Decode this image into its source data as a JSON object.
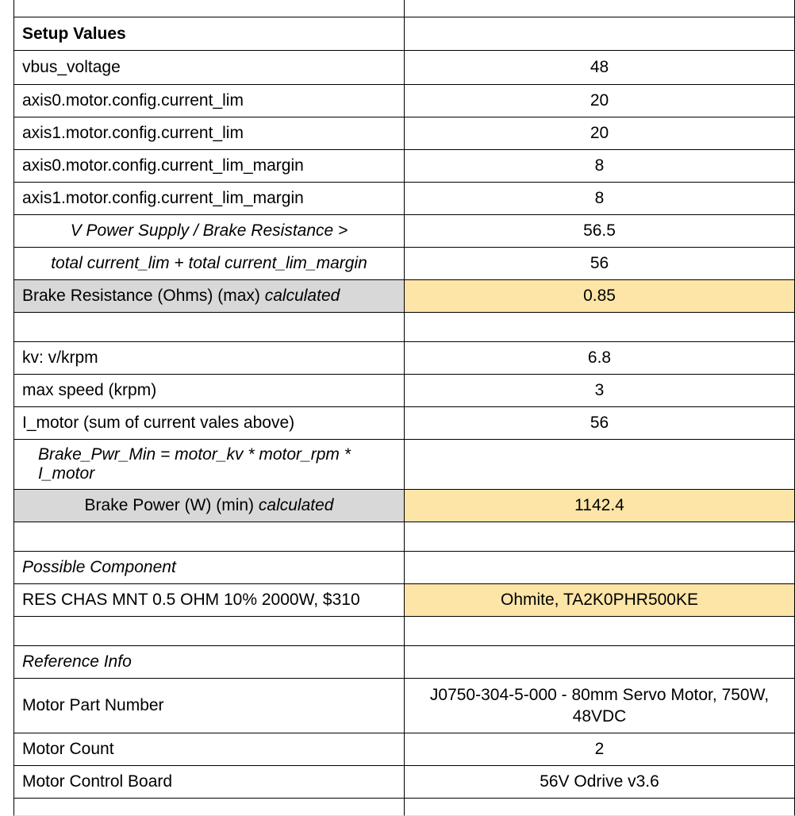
{
  "header": {
    "setup_values": "Setup Values"
  },
  "setup": {
    "vbus_label": "vbus_voltage",
    "vbus_value": "48",
    "axis0_current_lim_label": "axis0.motor.config.current_lim",
    "axis0_current_lim_value": "20",
    "axis1_current_lim_label": "axis1.motor.config.current_lim",
    "axis1_current_lim_value": "20",
    "axis0_current_lim_margin_label": "axis0.motor.config.current_lim_margin",
    "axis0_current_lim_margin_value": "8",
    "axis1_current_lim_margin_label": "axis1.motor.config.current_lim_margin",
    "axis1_current_lim_margin_value": "8",
    "vps_brake_label": "V Power Supply / Brake Resistance >",
    "vps_brake_value": "56.5",
    "total_current_label": "total current_lim + total current_lim_margin",
    "total_current_value": "56",
    "brake_resistance_label_a": "Brake Resistance (Ohms) (max) ",
    "brake_resistance_label_b": "calculated",
    "brake_resistance_value": "0.85"
  },
  "motor": {
    "kv_label": "kv: v/krpm",
    "kv_value": "6.8",
    "max_speed_label": "max speed (krpm)",
    "max_speed_value": "3",
    "i_motor_label": "I_motor (sum of current vales above)",
    "i_motor_value": "56",
    "brake_pwr_formula": "Brake_Pwr_Min = motor_kv * motor_rpm * I_motor",
    "brake_power_label_a": "Brake Power (W) (min) ",
    "brake_power_label_b": "calculated",
    "brake_power_value": "1142.4"
  },
  "component": {
    "section_label": "Possible Component",
    "desc": "RES CHAS MNT 0.5 OHM 10% 2000W, $310",
    "part": "Ohmite, TA2K0PHR500KE"
  },
  "reference": {
    "section_label": "Reference Info",
    "motor_pn_label": "Motor Part Number",
    "motor_pn_value": "J0750-304-5-000 - 80mm Servo Motor, 750W, 48VDC",
    "motor_count_label": "Motor Count",
    "motor_count_value": "2",
    "control_board_label": "Motor Control Board",
    "control_board_value": "56V Odrive v3.6"
  }
}
